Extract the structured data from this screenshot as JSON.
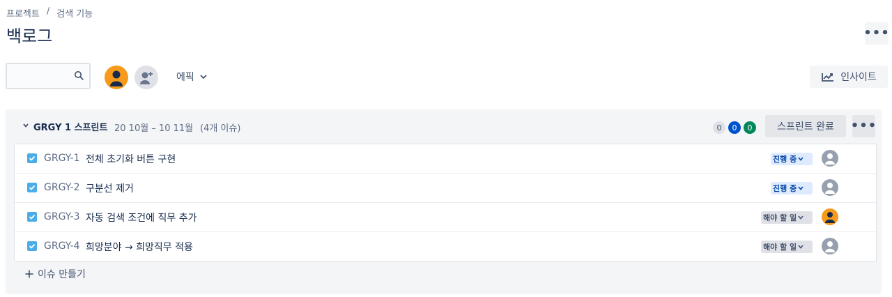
{
  "breadcrumb": {
    "project": "프로젝트",
    "separator": "/",
    "current": "검색 기능"
  },
  "page": {
    "title": "백로그"
  },
  "toolbar": {
    "search_placeholder": "",
    "epic_label": "에픽",
    "insight_label": "인사이트"
  },
  "sprint": {
    "name": "GRGY 1 스프린트",
    "dates": "20 10월 – 10 11월",
    "issue_count": "(4개 이슈)",
    "counts": {
      "todo": "0",
      "in_progress": "0",
      "done": "0"
    },
    "complete_label": "스프린트 완료",
    "issues": [
      {
        "key": "GRGY-1",
        "summary": "전체 초기화 버튼 구현",
        "status": "진행 중",
        "status_type": "inprogress",
        "assignee": "unassigned"
      },
      {
        "key": "GRGY-2",
        "summary": "구분선 제거",
        "status": "진행 중",
        "status_type": "inprogress",
        "assignee": "unassigned"
      },
      {
        "key": "GRGY-3",
        "summary": "자동 검색 조건에 직무 추가",
        "status": "해야 할 일",
        "status_type": "todo",
        "assignee": "user"
      },
      {
        "key": "GRGY-4",
        "summary": "희망분야 → 희망직무 적용",
        "status": "해야 할 일",
        "status_type": "todo",
        "assignee": "unassigned"
      }
    ],
    "create_issue_label": "이슈 만들기"
  },
  "colors": {
    "accent": "#0052cc",
    "done": "#00875a",
    "avatar": "#f79a1c",
    "story_icon": "#4bade8"
  }
}
